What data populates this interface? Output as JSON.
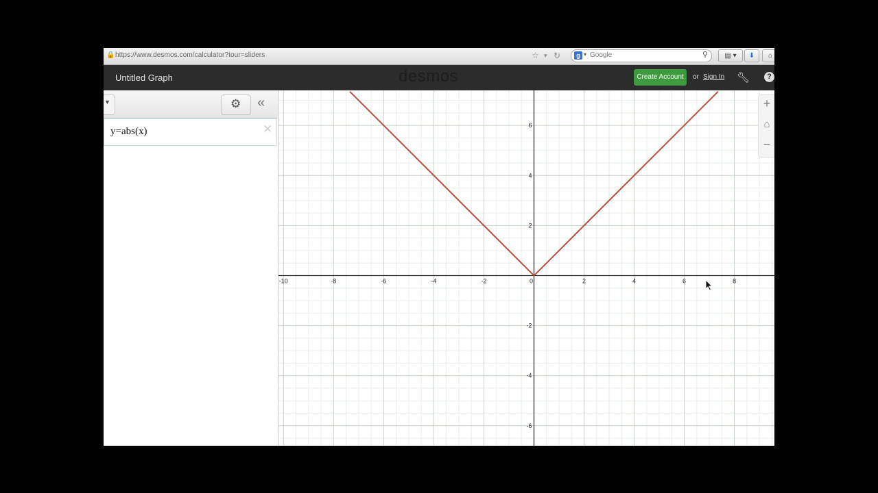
{
  "browser": {
    "url": "https://www.desmos.com/calculator?tour=sliders",
    "search_engine": "Google",
    "search_placeholder": "Google",
    "icons": [
      "lock-icon",
      "star-icon",
      "reload-icon",
      "google-icon",
      "search-icon",
      "bookmarks-icon",
      "download-icon",
      "home-icon"
    ]
  },
  "header": {
    "graph_title": "Untitled Graph",
    "brand": "desmos",
    "create_account": "Create Account",
    "or_text": "or",
    "sign_in": "Sign In",
    "help": "?"
  },
  "expressions": [
    {
      "latex_display": "y=abs(x)",
      "color": "#b5503a"
    }
  ],
  "colors": {
    "header_bg": "#2c2c2c",
    "create_account_bg": "#3e9a3e",
    "curve": "#b5503a",
    "grid_minor": "#e7efe7",
    "grid_major": "#c8d4c8",
    "axis": "#222222"
  },
  "chart_data": {
    "type": "line",
    "series": [
      {
        "name": "y=abs(x)",
        "x": [
          -7.35,
          0,
          7.35
        ],
        "y": [
          7.35,
          0,
          7.35
        ]
      }
    ],
    "xlim": [
      -10.2,
      9.6
    ],
    "ylim": [
      -6.8,
      7.4
    ],
    "x_ticks": [
      -10,
      -8,
      -6,
      -4,
      -2,
      0,
      2,
      4,
      6,
      8
    ],
    "y_ticks": [
      -6,
      -4,
      -2,
      2,
      4,
      6
    ],
    "grid": true,
    "title": "",
    "xlabel": "",
    "ylabel": ""
  }
}
